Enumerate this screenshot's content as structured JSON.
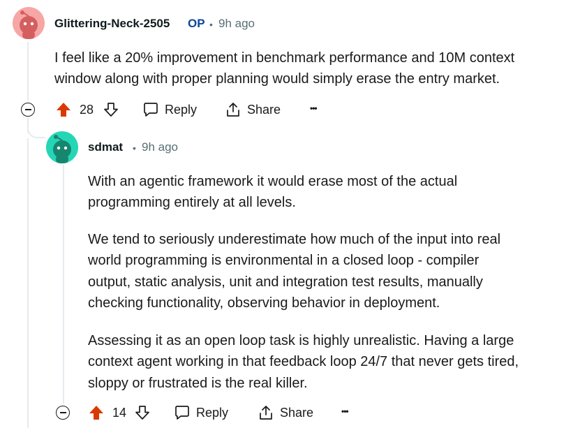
{
  "comments": [
    {
      "author": "Glittering-Neck-2505",
      "op_badge": "OP",
      "separator": "•",
      "time": "9h ago",
      "avatar_color": "#f7a6a6",
      "body": [
        "I feel like a 20% improvement in benchmark performance and 10M context",
        "window along with proper planning would simply erase the entry market."
      ],
      "votes": "28",
      "reply_label": "Reply",
      "share_label": "Share",
      "more_label": "•••"
    },
    {
      "author": "sdmat",
      "separator": "•",
      "time": "9h ago",
      "avatar_color": "#24d6b6",
      "body": [
        "With an agentic framework it would erase most of the actual",
        "programming entirely at all levels.",
        "We tend to seriously underestimate how much of the input into real",
        "world programming is environmental in a closed loop - compiler",
        "output, static analysis, unit and integration test results, manually",
        "checking functionality, observing behavior in deployment.",
        "Assessing it as an open loop task is highly unrealistic. Having a large",
        "context agent working in that feedback loop 24/7 that never gets tired,",
        "sloppy or frustrated is the real killer."
      ],
      "votes": "14",
      "reply_label": "Reply",
      "share_label": "Share",
      "more_label": "•••"
    }
  ],
  "colors": {
    "upvote": "#d93a00",
    "op": "#0a449b",
    "meta": "#576f76",
    "thread_line": "#e5ebee"
  }
}
